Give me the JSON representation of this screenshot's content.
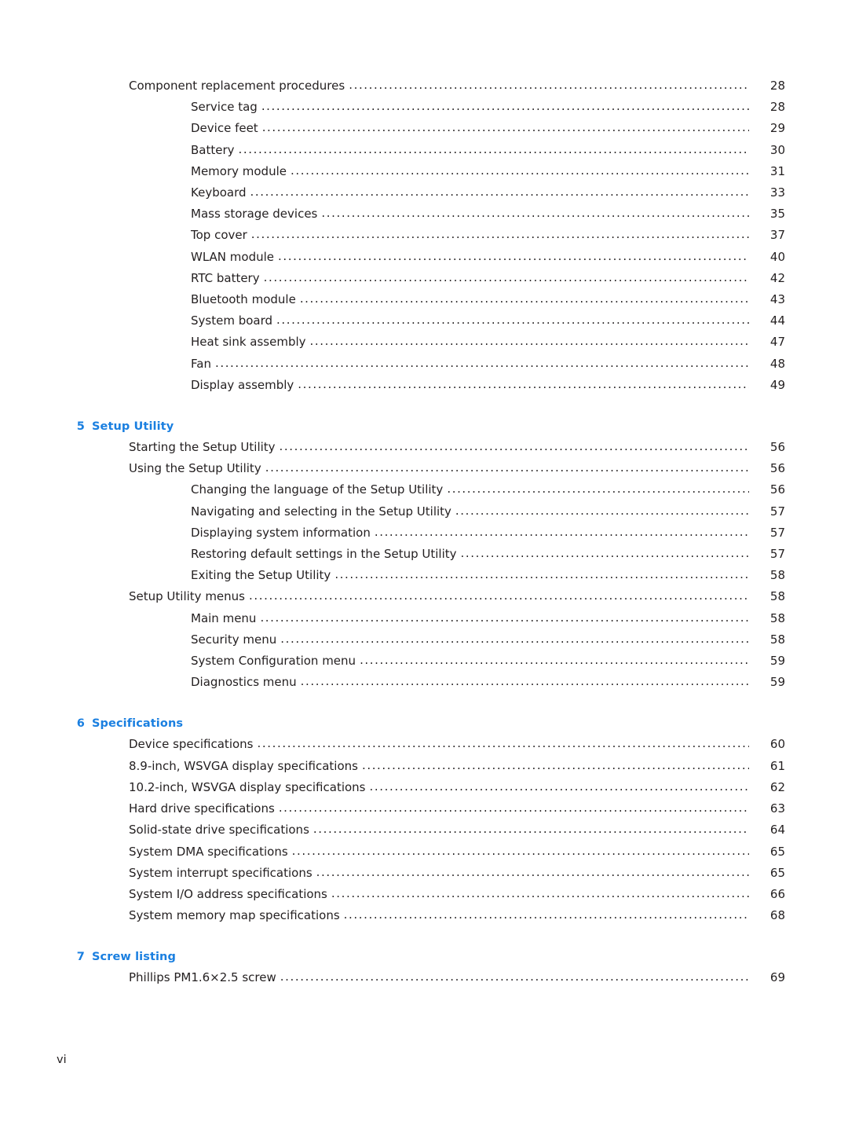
{
  "page": {
    "folio": "vi"
  },
  "toc": {
    "blocks": [
      {
        "type": "entries",
        "entries": [
          {
            "label": "Component replacement procedures",
            "page": "28",
            "indent": 1
          },
          {
            "label": "Service tag",
            "page": "28",
            "indent": 2
          },
          {
            "label": "Device feet",
            "page": "29",
            "indent": 2
          },
          {
            "label": "Battery",
            "page": "30",
            "indent": 2
          },
          {
            "label": "Memory module",
            "page": "31",
            "indent": 2
          },
          {
            "label": "Keyboard",
            "page": "33",
            "indent": 2
          },
          {
            "label": "Mass storage devices",
            "page": "35",
            "indent": 2
          },
          {
            "label": "Top cover",
            "page": "37",
            "indent": 2
          },
          {
            "label": "WLAN module",
            "page": "40",
            "indent": 2
          },
          {
            "label": "RTC battery",
            "page": "42",
            "indent": 2
          },
          {
            "label": "Bluetooth module",
            "page": "43",
            "indent": 2
          },
          {
            "label": "System board",
            "page": "44",
            "indent": 2
          },
          {
            "label": "Heat sink assembly",
            "page": "47",
            "indent": 2
          },
          {
            "label": "Fan",
            "page": "48",
            "indent": 2
          },
          {
            "label": "Display assembly",
            "page": "49",
            "indent": 2
          }
        ]
      },
      {
        "type": "chapter",
        "number": "5",
        "title": "Setup Utility",
        "entries": [
          {
            "label": "Starting the Setup Utility",
            "page": "56",
            "indent": 1
          },
          {
            "label": "Using the Setup Utility",
            "page": "56",
            "indent": 1
          },
          {
            "label": "Changing the language of the Setup Utility",
            "page": "56",
            "indent": 2
          },
          {
            "label": "Navigating and selecting in the Setup Utility",
            "page": "57",
            "indent": 2
          },
          {
            "label": "Displaying system information",
            "page": "57",
            "indent": 2
          },
          {
            "label": "Restoring default settings in the Setup Utility",
            "page": "57",
            "indent": 2
          },
          {
            "label": "Exiting the Setup Utility",
            "page": "58",
            "indent": 2
          },
          {
            "label": "Setup Utility menus",
            "page": "58",
            "indent": 1
          },
          {
            "label": "Main menu",
            "page": "58",
            "indent": 2
          },
          {
            "label": "Security menu",
            "page": "58",
            "indent": 2
          },
          {
            "label": "System Configuration menu",
            "page": "59",
            "indent": 2
          },
          {
            "label": "Diagnostics menu",
            "page": "59",
            "indent": 2
          }
        ]
      },
      {
        "type": "chapter",
        "number": "6",
        "title": "Specifications",
        "entries": [
          {
            "label": "Device specifications",
            "page": "60",
            "indent": 1
          },
          {
            "label": "8.9-inch, WSVGA display specifications",
            "page": "61",
            "indent": 1
          },
          {
            "label": "10.2-inch, WSVGA display specifications",
            "page": "62",
            "indent": 1
          },
          {
            "label": "Hard drive specifications",
            "page": "63",
            "indent": 1
          },
          {
            "label": "Solid-state drive specifications",
            "page": "64",
            "indent": 1
          },
          {
            "label": "System DMA specifications",
            "page": "65",
            "indent": 1
          },
          {
            "label": "System interrupt specifications",
            "page": "65",
            "indent": 1
          },
          {
            "label": "System I/O address specifications",
            "page": "66",
            "indent": 1
          },
          {
            "label": "System memory map specifications",
            "page": "68",
            "indent": 1
          }
        ]
      },
      {
        "type": "chapter",
        "number": "7",
        "title": "Screw listing",
        "entries": [
          {
            "label": "Phillips PM1.6×2.5 screw",
            "page": "69",
            "indent": 1
          }
        ]
      }
    ]
  },
  "colors": {
    "heading": "#1a7fe0",
    "text": "#231f20"
  }
}
